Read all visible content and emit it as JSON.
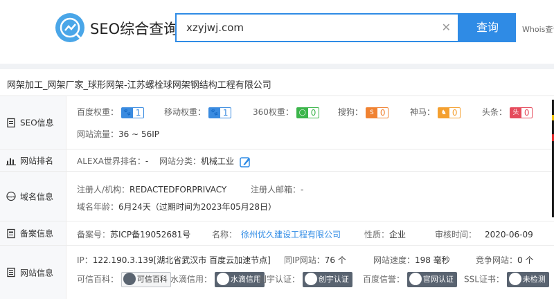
{
  "header": {
    "logo_text": "SEO综合查询",
    "search_value": "xzyjwj.com",
    "search_button": "查询",
    "whois_link": "Whois查询"
  },
  "site_title": "网架加工_网架厂家_球形网架-江苏螺栓球网架钢结构工程有限公司",
  "seo": {
    "label": "SEO信息",
    "baidu": {
      "label": "百度权重：",
      "value": "1"
    },
    "mobile": {
      "label": "移动权重：",
      "value": "1"
    },
    "r360": {
      "label": "360权重：",
      "value": "0"
    },
    "sogou": {
      "label": "搜狗：",
      "value": "0"
    },
    "shenma": {
      "label": "神马：",
      "value": "0"
    },
    "toutiao": {
      "label": "头条：",
      "value": "0"
    },
    "traffic_label": "网站流量：",
    "traffic_value": "36 ~ 56IP"
  },
  "ranking": {
    "label": "网站排名",
    "alexa_label": "ALEXA世界排名：",
    "alexa_value": "-",
    "category_label": "网站分类：",
    "category_value": "机械工业"
  },
  "domain": {
    "label": "域名信息",
    "registrant_label": "注册人/机构：",
    "registrant_value": "REDACTEDFORPRIVACY",
    "email_label": "注册人邮箱：",
    "email_value": "-",
    "age_label": "域名年龄：",
    "age_value": "6月24天（过期时间为2023年05月28日）"
  },
  "icp": {
    "label": "备案信息",
    "number_label": "备案号：",
    "number_value": "苏ICP备19052681号",
    "name_label": "名称：",
    "name_value": "徐州优久建设工程有限公司",
    "nature_label": "性质：",
    "nature_value": "企业",
    "audit_label": "审核时间：",
    "audit_value": "2020-06-09"
  },
  "siteinfo": {
    "label": "网站信息",
    "ip_label": "IP：",
    "ip_value": "122.190.3.139[湖北省武汉市 百度云加速节点]",
    "sameip_label": "同IP网站：",
    "sameip_value": "76 个",
    "speed_label": "网站速度：",
    "speed_value": "198 毫秒",
    "compete_label": "竞争网站：",
    "compete_value": "0 个",
    "baike_label": "可信百科：",
    "baike_badge": "可信百科",
    "water_label": "水滴信用：",
    "water_badge": "水滴信用",
    "chuangyu_label": "创宇认证：",
    "chuangyu_badge": "创宇认证",
    "baidu_credit_label": "百度信誉：",
    "baidu_credit_badge": "官网认证",
    "ssl_label": "SSL证书：",
    "ssl_badge": "未检测"
  },
  "colors": {
    "accent": "#2f8be5",
    "link": "#2f8be5",
    "green": "#3bb54a",
    "orange": "#f08232",
    "red": "#e54b5c"
  }
}
